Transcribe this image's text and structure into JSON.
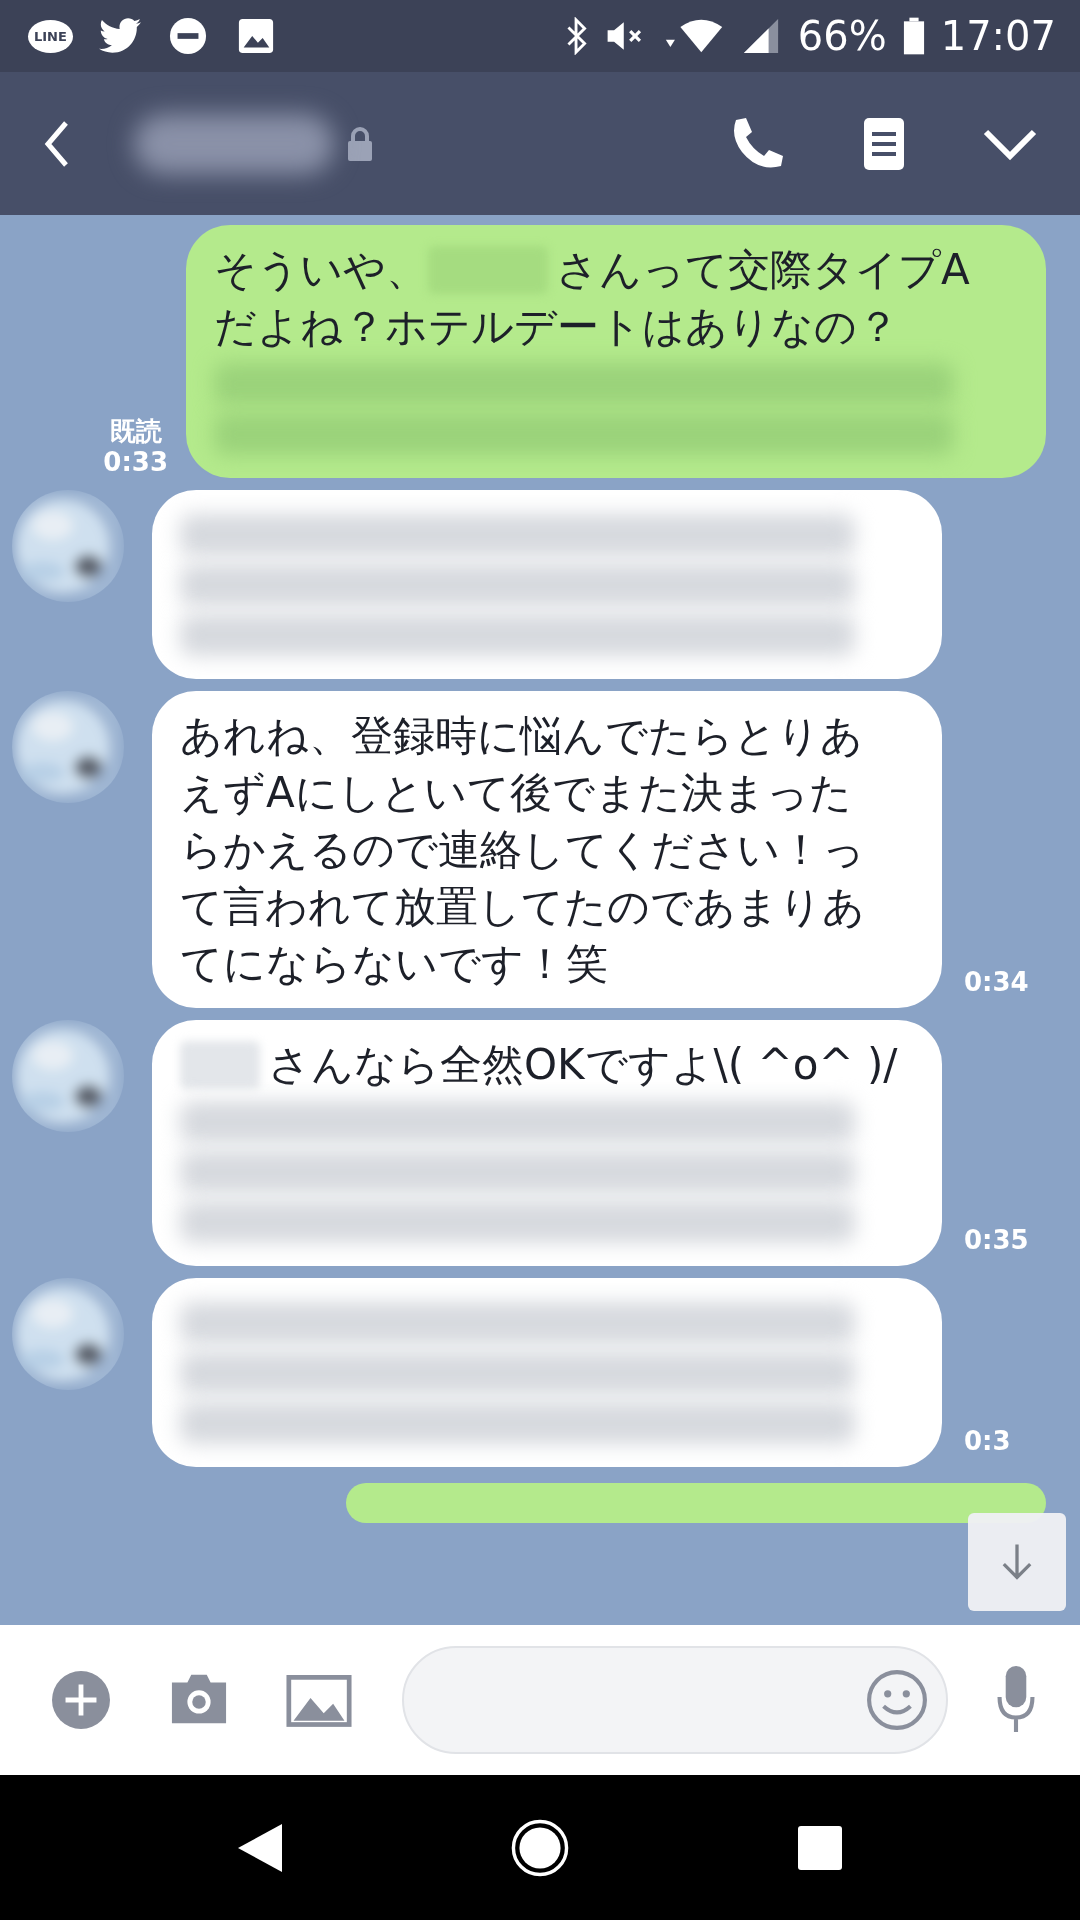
{
  "status_bar": {
    "line_badge": "LINE",
    "battery": "66%",
    "time": "17:07"
  },
  "messages": [
    {
      "kind": "sent",
      "read": "既読",
      "time": "0:33",
      "content": [
        {
          "kind": "line",
          "parts": [
            {
              "kind": "text",
              "text": "そういや、"
            },
            {
              "kind": "redacted_inline"
            },
            {
              "kind": "text",
              "text": "さんって交際タイプA"
            }
          ]
        },
        {
          "kind": "text",
          "text": "だよね？ホテルデートはありなの？"
        },
        {
          "kind": "redacted_line"
        },
        {
          "kind": "redacted_line"
        }
      ]
    },
    {
      "kind": "received",
      "content": [
        {
          "kind": "redacted_line"
        },
        {
          "kind": "redacted_line"
        },
        {
          "kind": "redacted_line"
        }
      ]
    },
    {
      "kind": "received",
      "time": "0:34",
      "content": [
        {
          "kind": "text",
          "text": "あれね、登録時に悩んでたらとりあえずAにしといて後でまた決まったらかえるので連絡してください！って言われて放置してたのであまりあてにならないです！笑"
        }
      ]
    },
    {
      "kind": "received",
      "time": "0:35",
      "content": [
        {
          "kind": "line",
          "parts": [
            {
              "kind": "redacted_inline"
            },
            {
              "kind": "text",
              "text": "さんなら全然OKですよ\\( ^o^ )/"
            }
          ]
        },
        {
          "kind": "redacted_line"
        },
        {
          "kind": "redacted_line"
        },
        {
          "kind": "redacted_line"
        }
      ]
    },
    {
      "kind": "received",
      "time": "0:3",
      "content": [
        {
          "kind": "redacted_line"
        },
        {
          "kind": "redacted_line"
        },
        {
          "kind": "redacted_line"
        }
      ]
    },
    {
      "kind": "sent_cut_off"
    }
  ]
}
